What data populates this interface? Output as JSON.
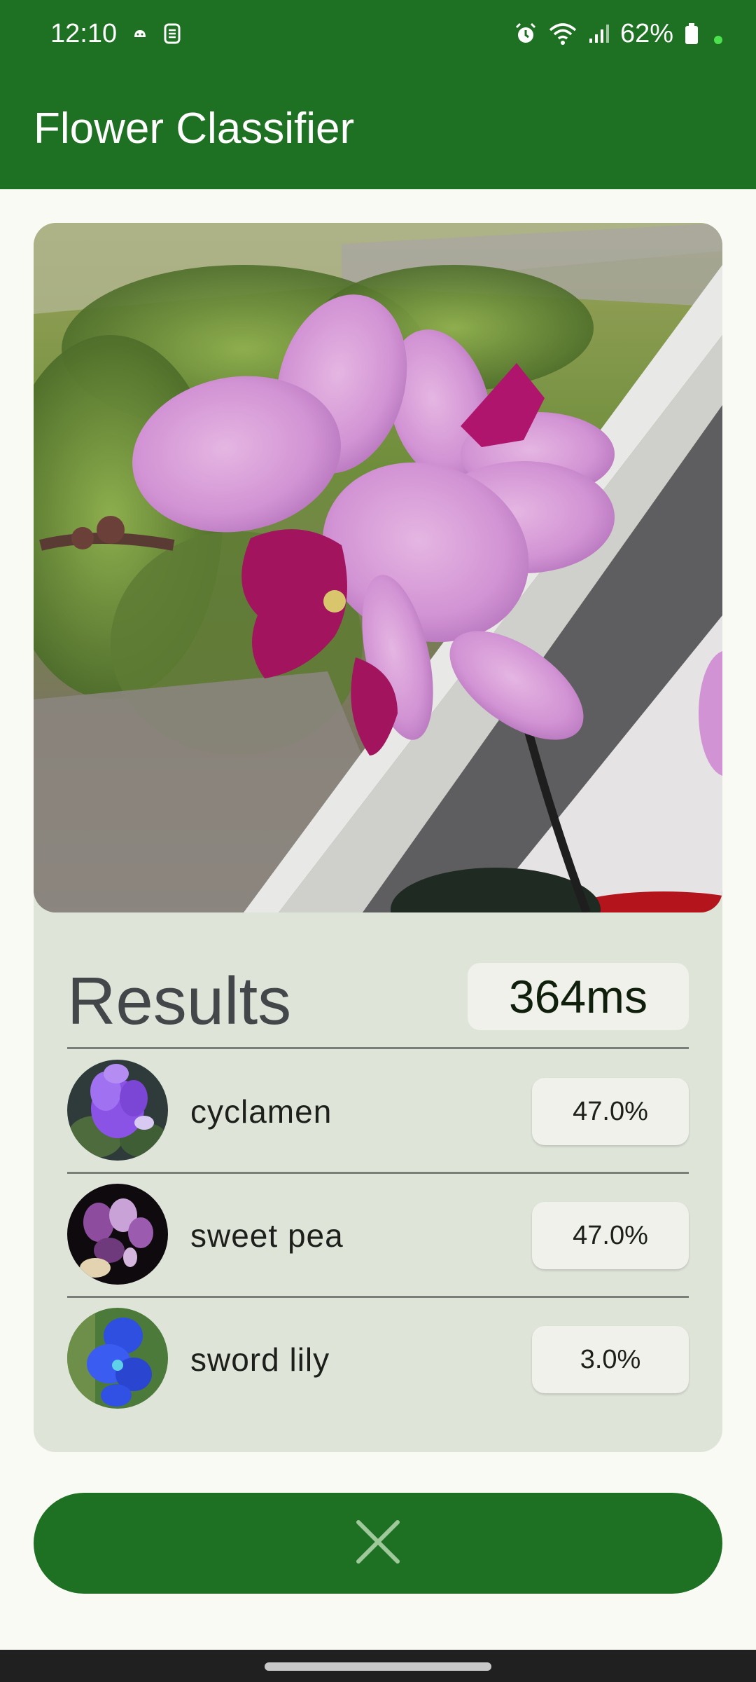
{
  "status_bar": {
    "time": "12:10",
    "battery": "62%",
    "icons": [
      "notification-icon",
      "sync-icon",
      "alarm-icon",
      "wifi-icon",
      "signal-icon",
      "battery-icon"
    ]
  },
  "app_bar": {
    "title": "Flower Classifier"
  },
  "results": {
    "title": "Results",
    "inference_time": "364ms",
    "items": [
      {
        "label": "cyclamen",
        "score": "47.0%"
      },
      {
        "label": "sweet pea",
        "score": "47.0%"
      },
      {
        "label": "sword lily",
        "score": "3.0%"
      }
    ]
  },
  "actions": {
    "close_icon": "close-icon"
  },
  "colors": {
    "primary": "#1E7023",
    "card": "#DFE4D9",
    "chip": "#EFF1EA",
    "background": "#F9FAF4"
  }
}
